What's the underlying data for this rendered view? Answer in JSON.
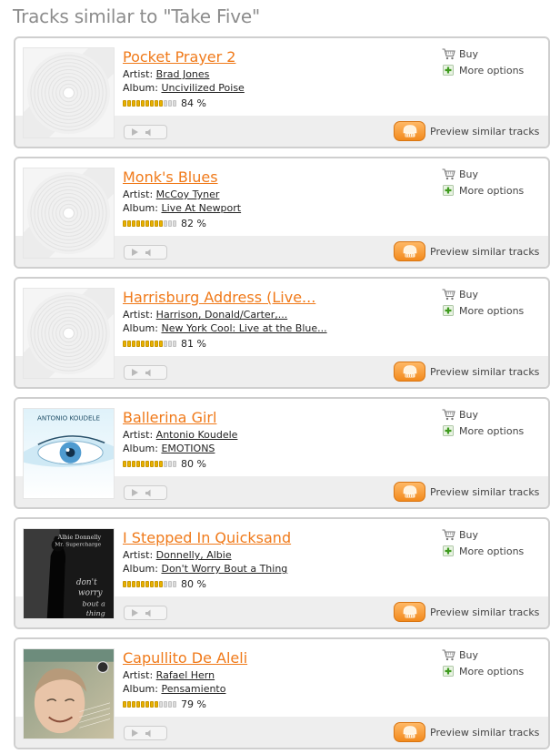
{
  "page": {
    "title": "Tracks similar to \"Take Five\""
  },
  "labels": {
    "artist": "Artist:",
    "album": "Album:",
    "buy": "Buy",
    "more_options": "More options",
    "preview": "Preview similar tracks"
  },
  "colors": {
    "accent": "#f07a1a",
    "rating_on": "#e8b200",
    "rating_off": "#dcdcdc",
    "preview_button": "#f28a1d"
  },
  "tracks": [
    {
      "title": "Pocket Prayer 2",
      "artist": "Brad Jones",
      "album": "Uncivilized Poise",
      "rating_pct": "84 %",
      "rating_fraction": 0.84,
      "cover": "placeholder"
    },
    {
      "title": "Monk's Blues",
      "artist": "McCoy Tyner",
      "album": "Live At Newport",
      "rating_pct": "82 %",
      "rating_fraction": 0.82,
      "cover": "placeholder"
    },
    {
      "title": "Harrisburg Address (Live...",
      "artist": "Harrison, Donald/Carter,...",
      "album": "New York Cool: Live at the Blue...",
      "rating_pct": "81 %",
      "rating_fraction": 0.81,
      "cover": "placeholder"
    },
    {
      "title": "Ballerina Girl",
      "artist": "Antonio Koudele",
      "album": "EMOTIONS",
      "rating_pct": "80 %",
      "rating_fraction": 0.8,
      "cover": "antonio",
      "cover_text": "ANTONIO KOUDELE"
    },
    {
      "title": "I Stepped In Quicksand",
      "artist": "Donnelly, Albie",
      "album": "Don't Worry Bout a Thing",
      "rating_pct": "80 %",
      "rating_fraction": 0.8,
      "cover": "donnelly",
      "cover_text": "Albie Donnelly Mr. Supercharge"
    },
    {
      "title": "Capullito De Aleli",
      "artist": "Rafael Hern",
      "album": "Pensamiento",
      "rating_pct": "79 %",
      "rating_fraction": 0.79,
      "cover": "rafael"
    }
  ]
}
